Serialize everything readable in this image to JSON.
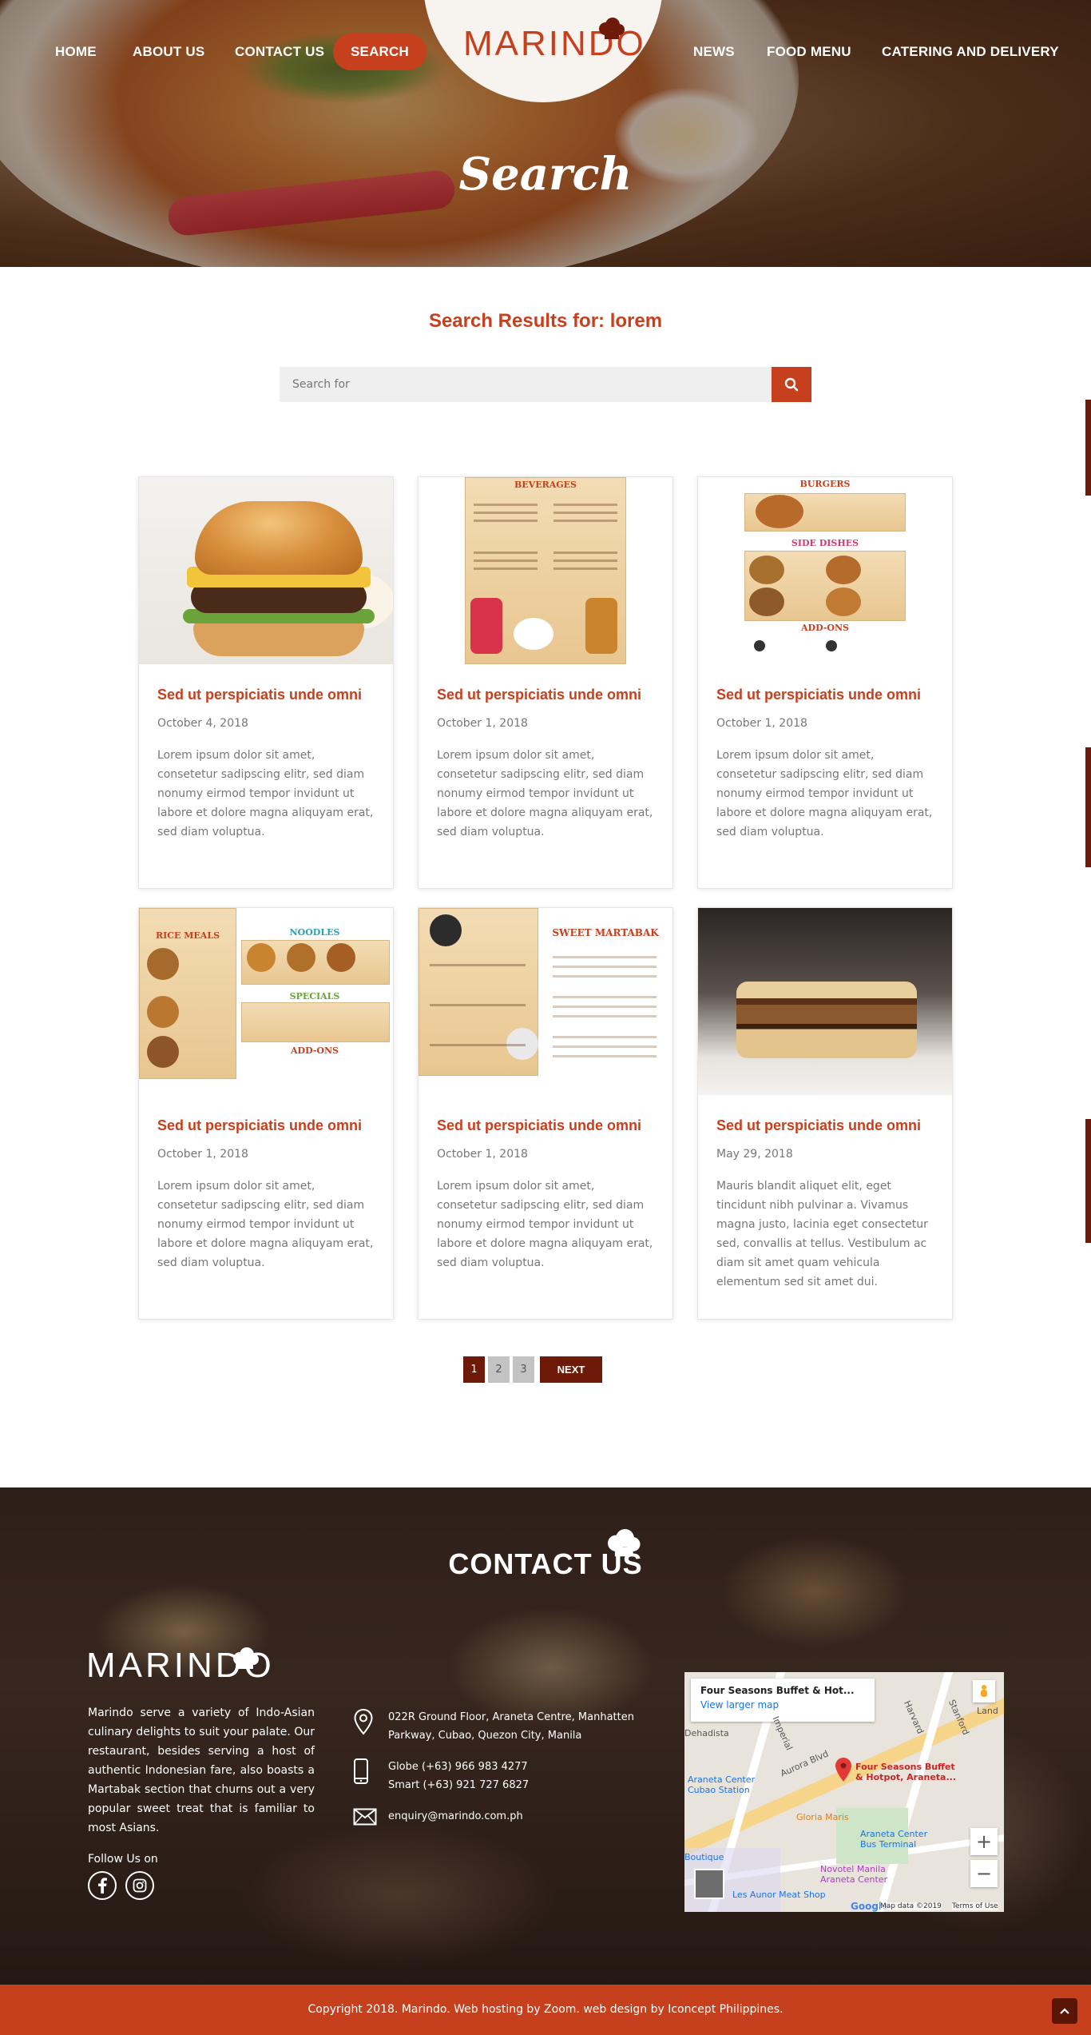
{
  "brand": {
    "name": "MARINDO",
    "accent": "#c7401e",
    "dark": "#6d1b08"
  },
  "nav": {
    "home": "HOME",
    "about": "ABOUT US",
    "contact": "CONTACT US",
    "search": "SEARCH",
    "news": "NEWS",
    "food_menu": "FOOD MENU",
    "catering": "CATERING AND DELIVERY"
  },
  "hero": {
    "title": "Search"
  },
  "search": {
    "results_title": "Search Results for: lorem",
    "placeholder": "Search for",
    "button_icon": "search-icon"
  },
  "posts": [
    {
      "title": "Sed ut perspiciatis unde omni",
      "date": "October 4, 2018",
      "excerpt": "Lorem ipsum dolor sit amet, consetetur sadipscing elitr, sed diam nonumy eirmod tempor invidunt ut labore et dolore magna aliquyam erat, sed diam voluptua.",
      "image": "burger"
    },
    {
      "title": "Sed ut perspiciatis unde omni",
      "date": "October 1, 2018",
      "excerpt": "Lorem ipsum dolor sit amet, consetetur sadipscing elitr, sed diam nonumy eirmod tempor invidunt ut labore et dolore magna aliquyam erat, sed diam voluptua.",
      "image": "beverages-menu"
    },
    {
      "title": "Sed ut perspiciatis unde omni",
      "date": "October 1, 2018",
      "excerpt": "Lorem ipsum dolor sit amet, consetetur sadipscing elitr, sed diam nonumy eirmod tempor invidunt ut labore et dolore magna aliquyam erat, sed diam voluptua.",
      "image": "burgers-menu"
    },
    {
      "title": "Sed ut perspiciatis unde omni",
      "date": "October 1, 2018",
      "excerpt": "Lorem ipsum dolor sit amet, consetetur sadipscing elitr, sed diam nonumy eirmod tempor invidunt ut labore et dolore magna aliquyam erat, sed diam voluptua.",
      "image": "rice-meals-menu"
    },
    {
      "title": "Sed ut perspiciatis unde omni",
      "date": "October 1, 2018",
      "excerpt": "Lorem ipsum dolor sit amet, consetetur sadipscing elitr, sed diam nonumy eirmod tempor invidunt ut labore et dolore magna aliquyam erat, sed diam voluptua.",
      "image": "sweet-martabak-menu"
    },
    {
      "title": "Sed ut perspiciatis unde omni",
      "date": "May 29, 2018",
      "excerpt": "Mauris blandit aliquet elit, eget tincidunt nibh pulvinar a. Vivamus magna justo, lacinia eget consectetur sed, convallis at tellus. Vestibulum ac diam sit amet quam vehicula elementum sed sit amet dui.",
      "image": "martabak-photo"
    }
  ],
  "menu_headings": {
    "beverages": "BEVERAGES",
    "burgers": "BURGERS",
    "side_dishes": "SIDE DISHES",
    "add_ons": "ADD-ONS",
    "rice_meals": "RICE MEALS",
    "noodles": "NOODLES",
    "specials": "SPECIALS",
    "sweet_martabak": "SWEET MARTABAK"
  },
  "pagination": {
    "pages": [
      "1",
      "2",
      "3"
    ],
    "current": "1",
    "next": "NEXT"
  },
  "contact": {
    "title": "CONTACT US",
    "logo": "MARINDO",
    "description": "Marindo serve a variety of Indo-Asian culinary delights to suit your palate. Our restaurant, besides serving a host of authentic Indonesian fare, also boasts a Martabak section that churns out a very popular sweet treat that is familiar to most Asians.",
    "follow_label": "Follow Us on",
    "address": "022R Ground Floor, Araneta Centre, Manhatten Parkway, Cubao, Quezon City, Manila",
    "phone_globe": "Globe (+63) 966 983 4277",
    "phone_smart": "Smart (+63) 921 727 6827",
    "email": "enquiry@marindo.com.ph"
  },
  "map": {
    "place": "Four Seasons Buffet & Hot...",
    "larger": "View larger map",
    "pin_label_1": "Four Seasons Buffet",
    "pin_label_2": "& Hotpot, Araneta...",
    "labels": [
      "Aurora Blvd",
      "Araneta Center Cubao Station",
      "Gloria Maris",
      "Araneta Center Bus Terminal",
      "Novotel Manila Araneta Center",
      "Les Aunor Meat Shop",
      "Boutique",
      "Dehadista",
      "Harvard",
      "Stanford",
      "Imperial",
      "Land"
    ],
    "attribution": "Map data ©2019",
    "terms": "Terms of Use",
    "google": "Google"
  },
  "footer": {
    "copyright": "Copyright 2018. Marindo. Web hosting by Zoom. web design by Iconcept Philippines."
  }
}
